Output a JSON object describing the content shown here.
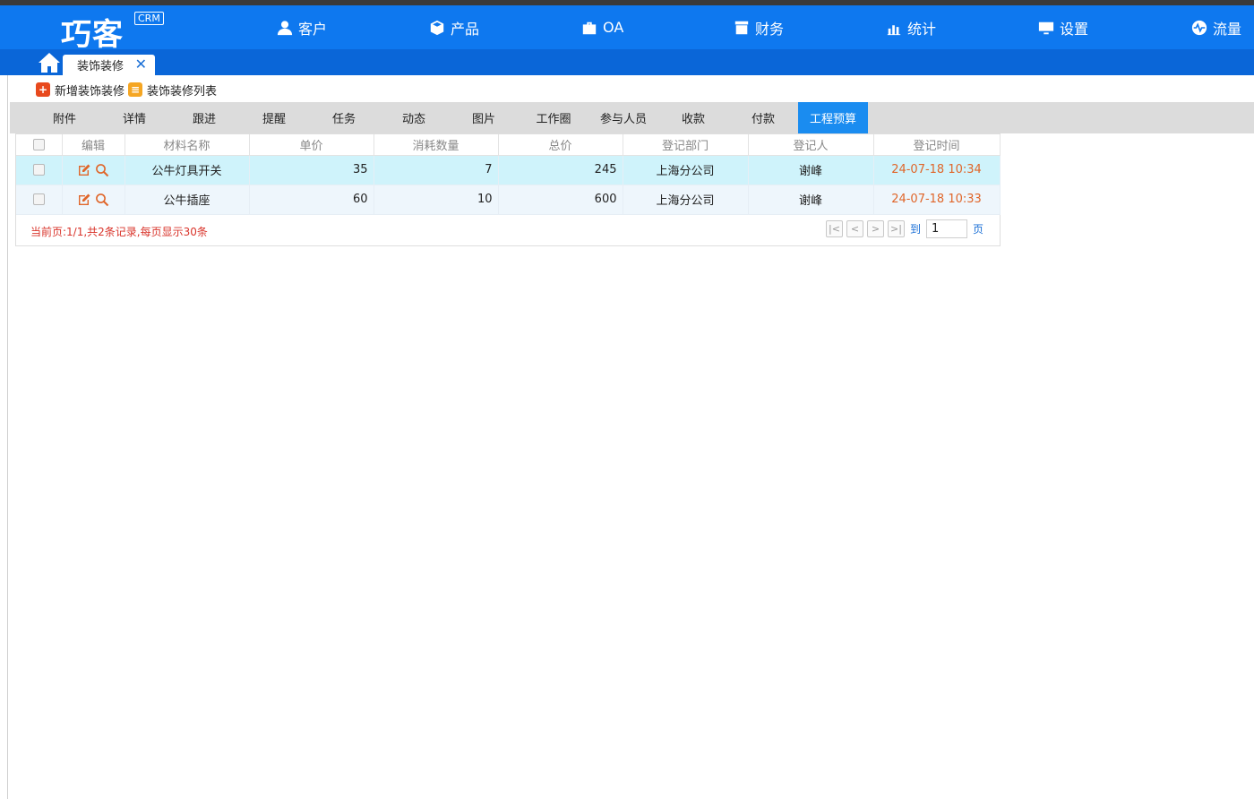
{
  "app": {
    "logo_text": "巧客",
    "logo_badge": "CRM"
  },
  "nav": [
    {
      "label": "客户",
      "icon": "user-icon"
    },
    {
      "label": "产品",
      "icon": "box-icon"
    },
    {
      "label": "OA",
      "icon": "briefcase-icon"
    },
    {
      "label": "财务",
      "icon": "finance-icon"
    },
    {
      "label": "统计",
      "icon": "chart-icon"
    },
    {
      "label": "设置",
      "icon": "monitor-icon"
    },
    {
      "label": "流量",
      "icon": "pulse-icon"
    }
  ],
  "page_tab": {
    "label": "装饰装修",
    "close": "✕"
  },
  "toolbar": {
    "add_label": "新增装饰装修",
    "list_label": "装饰装修列表",
    "add_glyph": "+",
    "list_glyph": "≡"
  },
  "subtabs": [
    "附件",
    "详情",
    "跟进",
    "提醒",
    "任务",
    "动态",
    "图片",
    "工作圈",
    "参与人员",
    "收款",
    "付款",
    "工程预算"
  ],
  "active_subtab": "工程预算",
  "table": {
    "headers": [
      "编辑",
      "材料名称",
      "单价",
      "消耗数量",
      "总价",
      "登记部门",
      "登记人",
      "登记时间"
    ],
    "rows": [
      {
        "name": "公牛灯具开关",
        "price": "35",
        "qty": "7",
        "total": "245",
        "dept": "上海分公司",
        "person": "谢峰",
        "time": "24-07-18 10:34"
      },
      {
        "name": "公牛插座",
        "price": "60",
        "qty": "10",
        "total": "600",
        "dept": "上海分公司",
        "person": "谢峰",
        "time": "24-07-18 10:33"
      }
    ]
  },
  "pager": {
    "info": "当前页:1/1,共2条记录,每页显示30条",
    "goto_label": "到",
    "page_value": "1",
    "page_suffix": "页"
  },
  "colors": {
    "header_blue": "#0e78ef",
    "tabbar_blue": "#0a66d8",
    "active_tab": "#1a8cf0",
    "time_orange": "#e0662a",
    "pager_red": "#d9342b"
  }
}
